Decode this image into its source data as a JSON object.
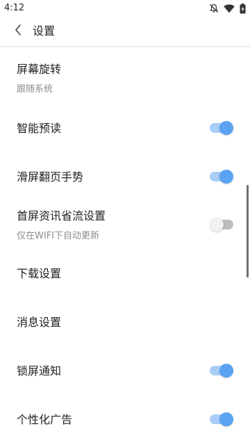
{
  "status_bar": {
    "time": "4:12",
    "icons": [
      "notifications-off-icon",
      "wifi-icon",
      "battery-charging-icon"
    ]
  },
  "app_bar": {
    "back_icon": "chevron-left-icon",
    "title": "设置"
  },
  "settings": {
    "items": [
      {
        "label": "屏幕旋转",
        "sublabel": "跟随系统",
        "control": "none"
      },
      {
        "label": "智能预读",
        "control": "toggle",
        "checked": true
      },
      {
        "label": "滑屏翻页手势",
        "control": "toggle",
        "checked": true
      },
      {
        "label": "首屏资讯省流设置",
        "sublabel": "仅在WIFI下自动更新",
        "control": "toggle",
        "checked": false
      },
      {
        "label": "下载设置",
        "control": "none"
      },
      {
        "label": "消息设置",
        "control": "none"
      },
      {
        "label": "锁屏通知",
        "control": "toggle",
        "checked": true
      },
      {
        "label": "个性化广告",
        "control": "toggle",
        "checked": true
      }
    ]
  },
  "colors": {
    "toggle_on_knob": "#5aa3f2",
    "toggle_on_track": "#a9cdf7",
    "toggle_off_knob": "#f1f1f1",
    "toggle_off_track": "#bdbdbd",
    "text_primary": "#222222",
    "text_secondary": "#8c8c8c"
  }
}
